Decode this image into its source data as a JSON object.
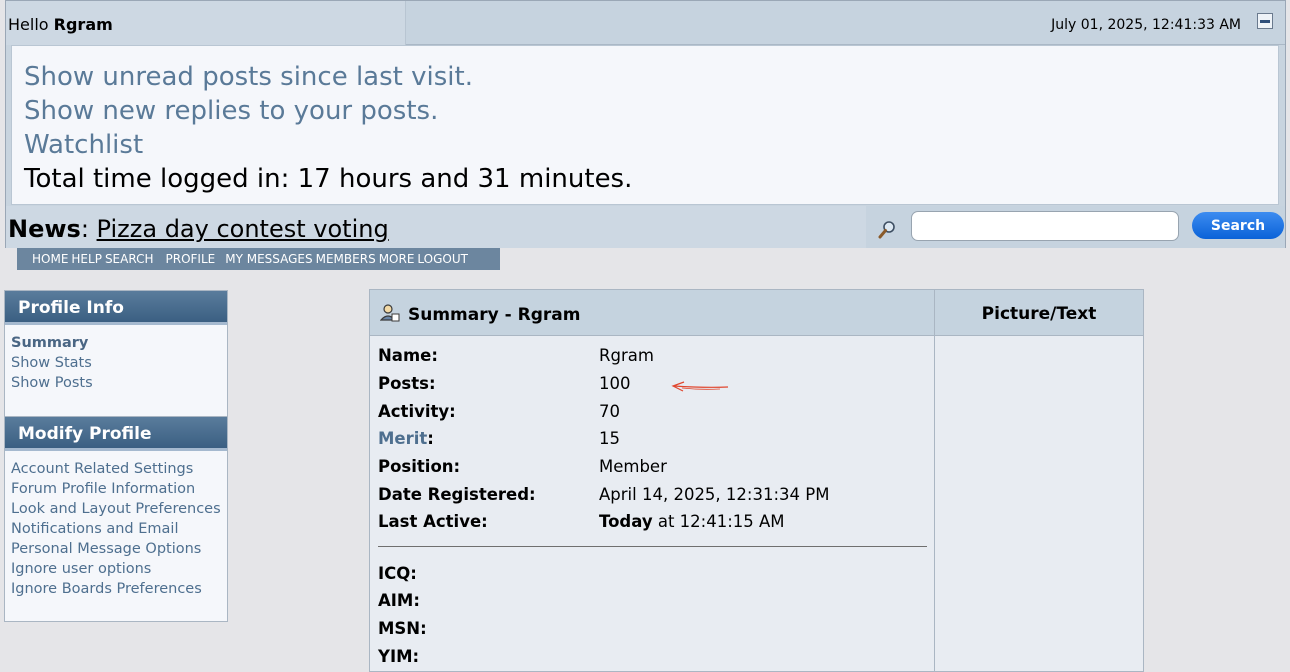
{
  "header": {
    "greeting": "Hello",
    "username": "Rgram",
    "datetime": "July 01, 2025, 12:41:33 AM"
  },
  "quick_links": {
    "unread": "Show unread posts since last visit.",
    "replies": "Show new replies to your posts.",
    "watchlist": "Watchlist",
    "time_logged": "Total time logged in: 17 hours and 31 minutes."
  },
  "news": {
    "label": "News",
    "headline": "Pizza day contest voting"
  },
  "search": {
    "placeholder": "",
    "button_label": "Search"
  },
  "menu": [
    "HOME",
    "HELP",
    "SEARCH",
    "PROFILE",
    "MY MESSAGES",
    "MEMBERS",
    "MORE",
    "LOGOUT"
  ],
  "sidebar": {
    "profile_info": {
      "title": "Profile Info",
      "items": [
        "Summary",
        "Show Stats",
        "Show Posts"
      ]
    },
    "modify_profile": {
      "title": "Modify Profile",
      "items": [
        "Account Related Settings",
        "Forum Profile Information",
        "Look and Layout Preferences",
        "Notifications and Email",
        "Personal Message Options",
        "Ignore user options",
        "Ignore Boards Preferences"
      ]
    }
  },
  "summary": {
    "title": "Summary - Rgram",
    "name_label": "Name:",
    "name": "Rgram",
    "posts_label": "Posts:",
    "posts": "100",
    "activity_label": "Activity:",
    "activity": "70",
    "merit_label": "Merit",
    "merit": "15",
    "position_label": "Position:",
    "position": "Member",
    "registered_label": "Date Registered:",
    "registered": "April 14, 2025, 12:31:34 PM",
    "last_active_label": "Last Active:",
    "last_active_day": "Today",
    "last_active_time": "at 12:41:15 AM",
    "icq_label": "ICQ:",
    "aim_label": "AIM:",
    "msn_label": "MSN:",
    "yim_label": "YIM:"
  },
  "picture": {
    "title": "Picture/Text"
  },
  "colors": {
    "accent_link": "#5a7a98",
    "header_bg": "#c6d3df",
    "search_button": "#0a62d8",
    "annotation": "#e0462e"
  }
}
